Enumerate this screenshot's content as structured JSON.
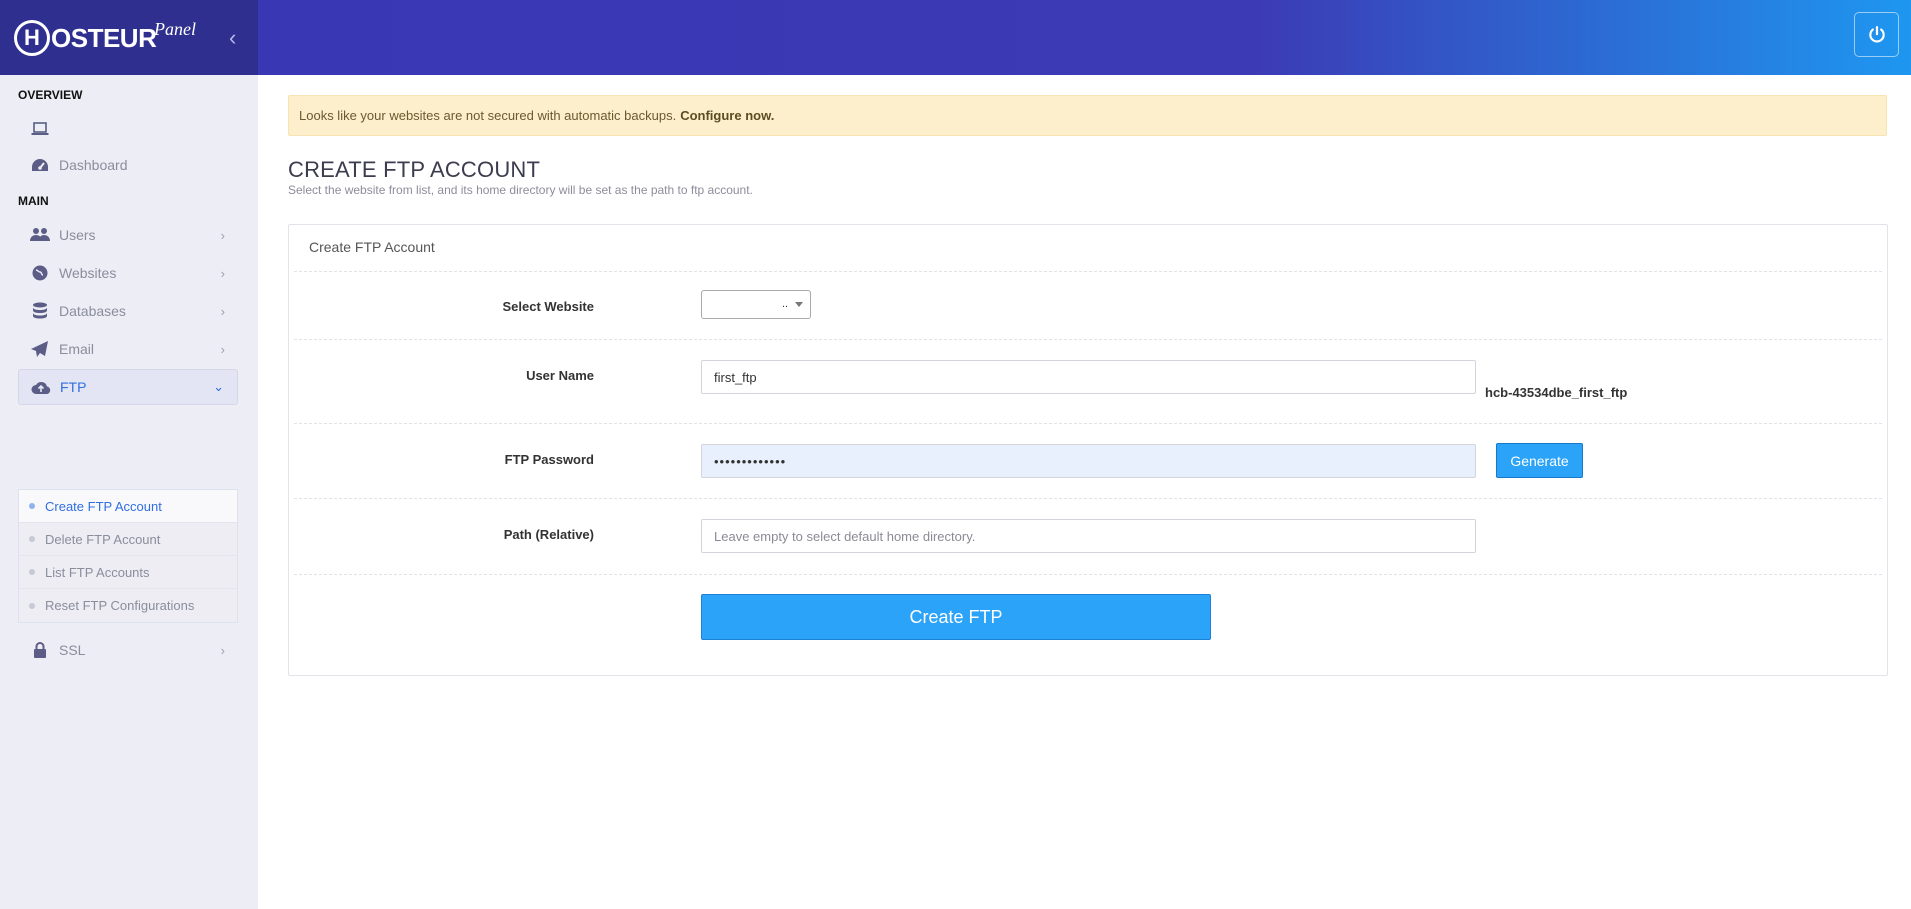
{
  "brand": {
    "logo_letter": "H",
    "logo_text": "OSTEUR",
    "panel_label": "Panel",
    "collapse_icon": "chevron-left-icon",
    "accent": "#2aa3f8"
  },
  "header": {
    "power_icon": "power-icon"
  },
  "sidebar": {
    "overview_title": "OVERVIEW",
    "main_title": "MAIN",
    "items": [
      {
        "label": "",
        "icon": "laptop-icon"
      },
      {
        "label": "Dashboard",
        "icon": "dashboard-icon"
      },
      {
        "label": "Users",
        "icon": "users-icon"
      },
      {
        "label": "Websites",
        "icon": "globe-icon"
      },
      {
        "label": "Databases",
        "icon": "database-icon"
      },
      {
        "label": "Email",
        "icon": "paper-plane-icon"
      },
      {
        "label": "FTP",
        "icon": "cloud-upload-icon"
      },
      {
        "label": "SSL",
        "icon": "lock-icon"
      }
    ],
    "ftp_sub": [
      {
        "label": "Create FTP Account"
      },
      {
        "label": "Delete FTP Account"
      },
      {
        "label": "List FTP Accounts"
      },
      {
        "label": "Reset FTP Configurations"
      }
    ]
  },
  "alert": {
    "text": "Looks like your websites are not secured with automatic backups.",
    "link": "Configure now."
  },
  "page": {
    "title": "CREATE FTP ACCOUNT",
    "subtitle": "Select the website from list, and its home directory will be set as the path to ftp account."
  },
  "form": {
    "card_title": "Create FTP Account",
    "select_website_label": "Select Website",
    "select_website_value": "..",
    "username_label": "User Name",
    "username_value": "first_ftp",
    "username_suffix": "hcb-43534dbe_first_ftp",
    "password_label": "FTP Password",
    "password_value": "•••••••••••••",
    "generate_label": "Generate",
    "path_label": "Path (Relative)",
    "path_placeholder": "Leave empty to select default home directory.",
    "submit_label": "Create FTP"
  }
}
